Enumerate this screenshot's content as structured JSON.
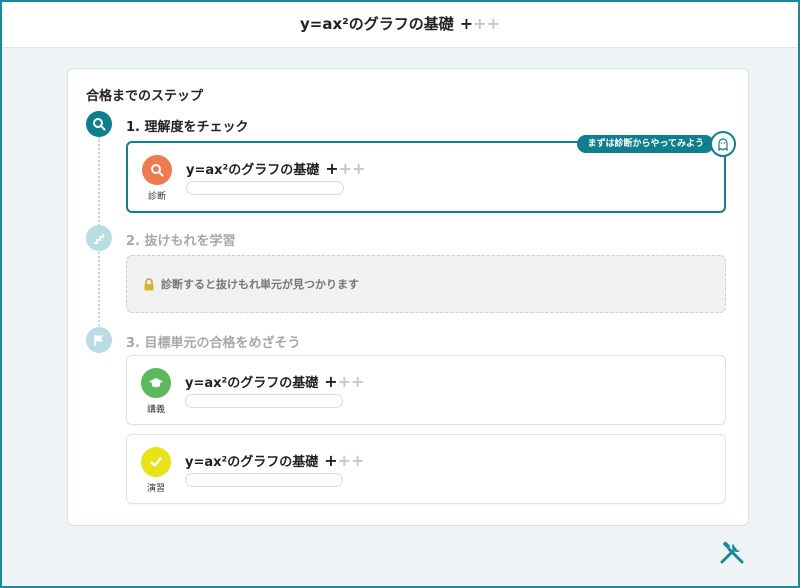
{
  "header": {
    "title": "y=ax²のグラフの基礎",
    "plus_dark": "+",
    "plus_light": "++"
  },
  "main": {
    "section_title": "合格までのステップ",
    "steps": [
      {
        "label": "1. 理解度をチェック",
        "icon": "search-icon",
        "state": "active",
        "item": {
          "type": "診断",
          "title": "y=ax²のグラフの基礎",
          "plus_dark": "+",
          "plus_light": "++",
          "icon": "search-icon",
          "icon_color": "#ee7a4f",
          "callout": "まずは診断からやってみよう"
        }
      },
      {
        "label": "2. 抜けもれを学習",
        "icon": "stairs-icon",
        "state": "inactive",
        "locked_message": "診断すると抜けもれ単元が見つかります"
      },
      {
        "label": "3. 目標単元の合格をめざそう",
        "icon": "flag-icon",
        "state": "inactive",
        "items": [
          {
            "type": "講義",
            "title": "y=ax²のグラフの基礎",
            "plus_dark": "+",
            "plus_light": "++",
            "icon": "graduation-cap-icon",
            "icon_color": "#5cb85c"
          },
          {
            "type": "演習",
            "title": "y=ax²のグラフの基礎",
            "plus_dark": "+",
            "plus_light": "++",
            "icon": "check-icon",
            "icon_color": "#e8e21a"
          }
        ]
      }
    ]
  },
  "colors": {
    "accent": "#0f7f8e",
    "inactive": "#b9dde3",
    "background": "#eef4f5"
  },
  "footer_icon": "tools-icon"
}
